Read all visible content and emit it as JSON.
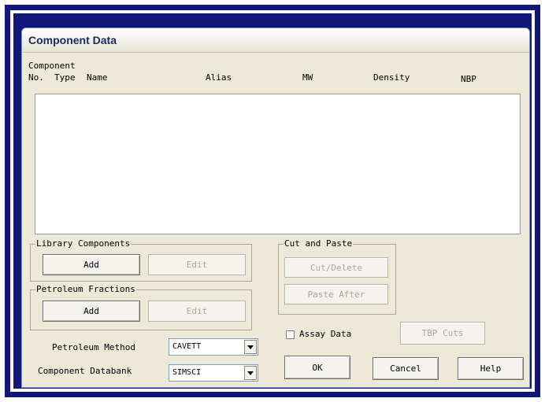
{
  "window": {
    "title": "Component Data"
  },
  "list_header": {
    "line1": "Component",
    "columns": [
      "No.",
      "Type",
      "Name",
      "Alias",
      "MW",
      "Density",
      "NBP"
    ]
  },
  "library_components": {
    "label": "Library Components",
    "add": "Add",
    "edit": "Edit"
  },
  "petroleum_fractions": {
    "label": "Petroleum Fractions",
    "add": "Add",
    "edit": "Edit"
  },
  "cut_and_paste": {
    "label": "Cut and Paste",
    "cut_delete": "Cut/Delete",
    "paste_after": "Paste After"
  },
  "assay": {
    "label": "Assay Data",
    "checked": false,
    "tbp_cuts": "TBP Cuts"
  },
  "petroleum_method": {
    "label": "Petroleum Method",
    "value": "CAVETT"
  },
  "component_databank": {
    "label": "Component Databank",
    "value": "SIMSCI"
  },
  "buttons": {
    "ok": "OK",
    "cancel": "Cancel",
    "help": "Help"
  }
}
